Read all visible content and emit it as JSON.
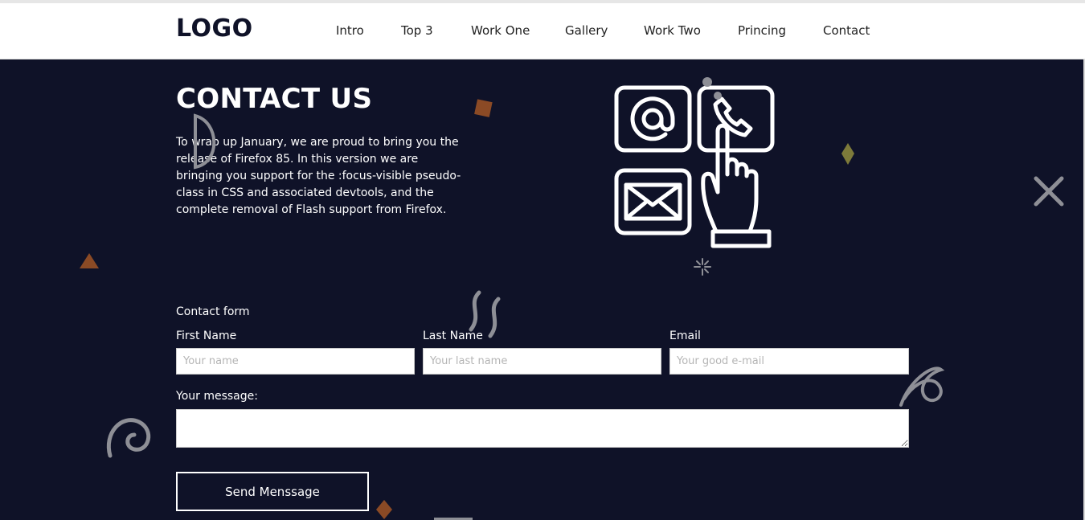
{
  "header": {
    "logo": "LOGO",
    "nav": [
      "Intro",
      "Top 3",
      "Work One",
      "Gallery",
      "Work Two",
      "Princing",
      "Contact"
    ]
  },
  "hero": {
    "title": "CONTACT US",
    "text": "To wrap up January, we are proud to bring you the release of Firefox 85. In this version we are bringing you support for the :focus-visible pseudo-class in CSS and associated devtools, and the complete removal of Flash support from Firefox."
  },
  "form": {
    "title": "Contact form",
    "first_name": {
      "label": "First Name",
      "placeholder": "Your name",
      "value": ""
    },
    "last_name": {
      "label": "Last Name",
      "placeholder": "Your last name",
      "value": ""
    },
    "email": {
      "label": "Email",
      "placeholder": "Your good e-mail",
      "value": ""
    },
    "message": {
      "label": "Your message:",
      "value": ""
    },
    "submit_label": "Send Menssage"
  },
  "icons": [
    "at-sign-icon",
    "phone-icon",
    "envelope-icon",
    "pointing-hand-icon"
  ],
  "colors": {
    "background": "#0f1228",
    "accent_orange": "#8b4a25",
    "accent_olive": "#7d7a3a",
    "decor_gray": "#8e8f96"
  }
}
